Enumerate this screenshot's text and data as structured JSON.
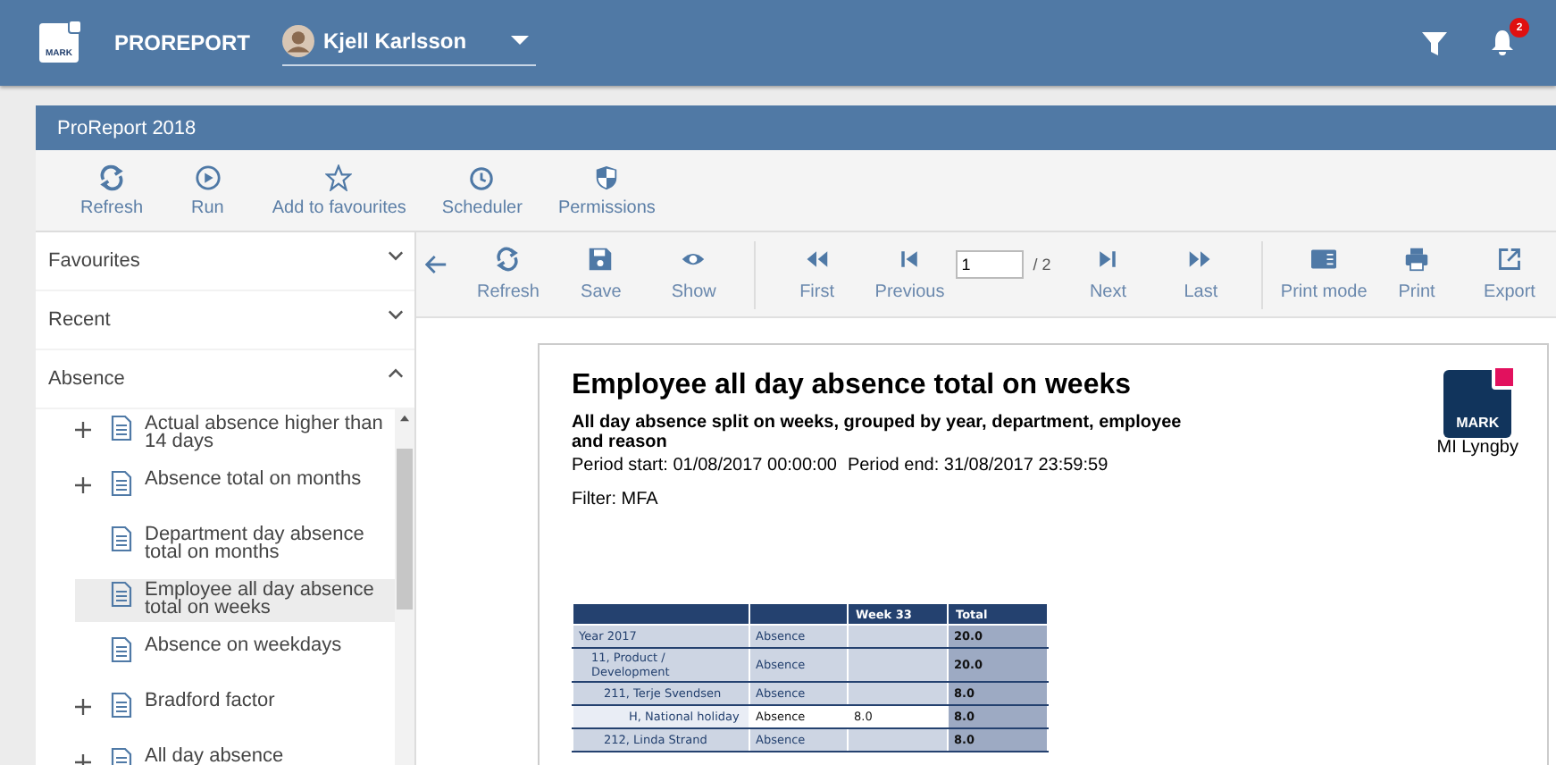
{
  "app_bar": {
    "logo_text": "MARK",
    "brand": "PROREPORT",
    "user": "Kjell Karlsson",
    "notification_count": "2"
  },
  "panel": {
    "title": "ProReport 2018"
  },
  "toolbar": [
    {
      "kind": "refresh",
      "label": "Refresh"
    },
    {
      "kind": "run",
      "label": "Run"
    },
    {
      "kind": "star",
      "label": "Add to favourites"
    },
    {
      "kind": "clock",
      "label": "Scheduler"
    },
    {
      "kind": "shield",
      "label": "Permissions"
    }
  ],
  "sidebar": {
    "sections": [
      {
        "label": "Favourites",
        "expanded": false
      },
      {
        "label": "Recent",
        "expanded": false
      },
      {
        "label": "Absence",
        "expanded": true,
        "items": [
          {
            "label": "Actual absence higher than 14 days",
            "expandable": true,
            "selected": false
          },
          {
            "label": "Absence total on months",
            "expandable": true,
            "selected": false
          },
          {
            "label": "Department day absence total on months",
            "expandable": false,
            "selected": false
          },
          {
            "label": "Employee all day absence total on weeks",
            "expandable": false,
            "selected": true
          },
          {
            "label": "Absence on weekdays",
            "expandable": false,
            "selected": false
          },
          {
            "label": "Bradford factor",
            "expandable": true,
            "selected": false
          },
          {
            "label": "All day absence",
            "expandable": true,
            "selected": false
          }
        ]
      }
    ]
  },
  "report_toolbar": {
    "actions": [
      {
        "kind": "refresh",
        "label": "Refresh"
      },
      {
        "kind": "save",
        "label": "Save"
      },
      {
        "kind": "eye",
        "label": "Show"
      }
    ],
    "nav_before": [
      {
        "kind": "first",
        "label": "First"
      },
      {
        "kind": "previous",
        "label": "Previous"
      }
    ],
    "pager": {
      "page": "1",
      "total": "/ 2"
    },
    "nav_after": [
      {
        "kind": "next",
        "label": "Next"
      },
      {
        "kind": "last",
        "label": "Last"
      }
    ],
    "output": [
      {
        "kind": "printmode",
        "label": "Print mode"
      },
      {
        "kind": "print",
        "label": "Print"
      },
      {
        "kind": "export",
        "label": "Export"
      }
    ]
  },
  "report": {
    "title": "Employee all day absence total on weeks",
    "subtitle": "All day absence split on weeks, grouped by year, department, employee and reason",
    "period_start": "Period start: 01/08/2017 00:00:00",
    "period_end": "Period end: 31/08/2017 23:59:59",
    "filter": "Filter: MFA",
    "logo_text": "MARK",
    "company": "MI Lyngby",
    "table": {
      "columns": [
        "Week 33",
        "Total"
      ],
      "rows": [
        {
          "label": "Year 2017",
          "kind": "group",
          "type": "Absence",
          "total": "20.0",
          "children": [
            {
              "label": "11, Product / Development",
              "kind": "group",
              "type": "Absence",
              "total": "20.0",
              "children": [
                {
                  "label": "211, Terje Svendsen",
                  "kind": "group",
                  "type": "Absence",
                  "total": "8.0",
                  "children": [
                    {
                      "label": "H, National holiday",
                      "kind": "detail",
                      "type": "Absence",
                      "week": "8.0",
                      "total": "8.0"
                    }
                  ]
                },
                {
                  "label": "212, Linda Strand",
                  "kind": "group",
                  "type": "Absence",
                  "total": "8.0"
                }
              ]
            }
          ]
        }
      ]
    }
  }
}
